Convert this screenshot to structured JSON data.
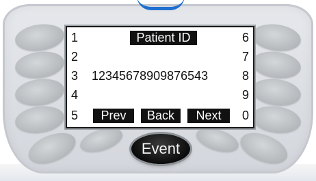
{
  "screen": {
    "title": "Patient ID",
    "value": "12345678909876543",
    "left_numbers": [
      "1",
      "2",
      "3",
      "4",
      "5"
    ],
    "right_numbers": [
      "6",
      "7",
      "8",
      "9",
      "0"
    ],
    "softkeys": {
      "prev": "Prev",
      "back": "Back",
      "next": "Next"
    }
  },
  "event_button": {
    "label": "Event"
  }
}
